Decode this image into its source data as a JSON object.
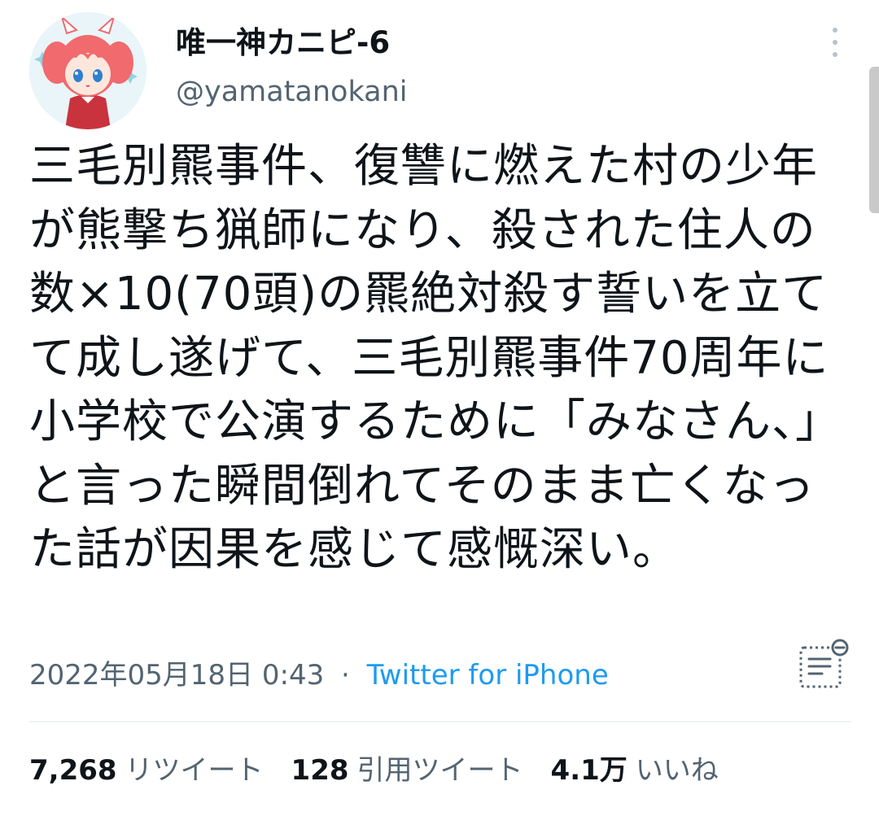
{
  "tweet": {
    "display_name": "唯一神カニピ-6",
    "handle": "@yamatanokani",
    "text": "三毛別羆事件、復讐に燃えた村の少年が熊撃ち猟師になり、殺された住人の数×10(70頭)の羆絶対殺す誓いを立てて成し遂げて、三毛別羆事件70周年に小学校で公演するために「みなさん、」と言った瞬間倒れてそのまま亡くなった話が因果を感じて感慨深い。",
    "timestamp": "2022年05月18日 0:43",
    "separator": "·",
    "source": "Twitter for iPhone"
  },
  "stats": {
    "retweets": {
      "count": "7,268",
      "label": "リツイート"
    },
    "quotes": {
      "count": "128",
      "label": "引用ツイート"
    },
    "likes": {
      "count": "4.1万",
      "label": "いいね"
    }
  },
  "icons": {
    "avatar": "anime-girl-avatar",
    "more": "vertical-dots-icon",
    "analytics": "analytics-icon"
  },
  "colors": {
    "text": "#0f1419",
    "secondary": "#536471",
    "link": "#1d9bf0",
    "divider": "#eff3f4"
  }
}
